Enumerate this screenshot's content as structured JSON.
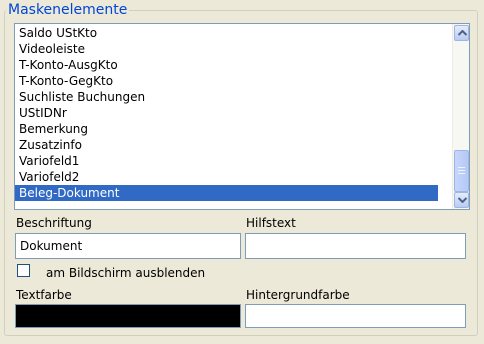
{
  "group": {
    "title": "Maskenelemente"
  },
  "list": {
    "items": [
      "Saldo UStKto",
      "Videoleiste",
      "T-Konto-AusgKto",
      "T-Konto-GegKto",
      "Suchliste Buchungen",
      "UStIDNr",
      "Bemerkung",
      "Zusatzinfo",
      "Variofeld1",
      "Variofeld2",
      "Beleg-Dokument"
    ],
    "selected_index": 10
  },
  "fields": {
    "caption_label": "Beschriftung",
    "caption_value": "Dokument",
    "helptext_label": "Hilfstext",
    "helptext_value": "",
    "hide_label": "am Bildschirm ausblenden",
    "hide_checked": false,
    "textcolor_label": "Textfarbe",
    "textcolor_value": "#000000",
    "bgcolor_label": "Hintergrundfarbe",
    "bgcolor_value": "#ffffff"
  },
  "colors": {
    "accent": "#0046d5",
    "selection": "#316ac5",
    "field_border": "#7f9db9"
  }
}
